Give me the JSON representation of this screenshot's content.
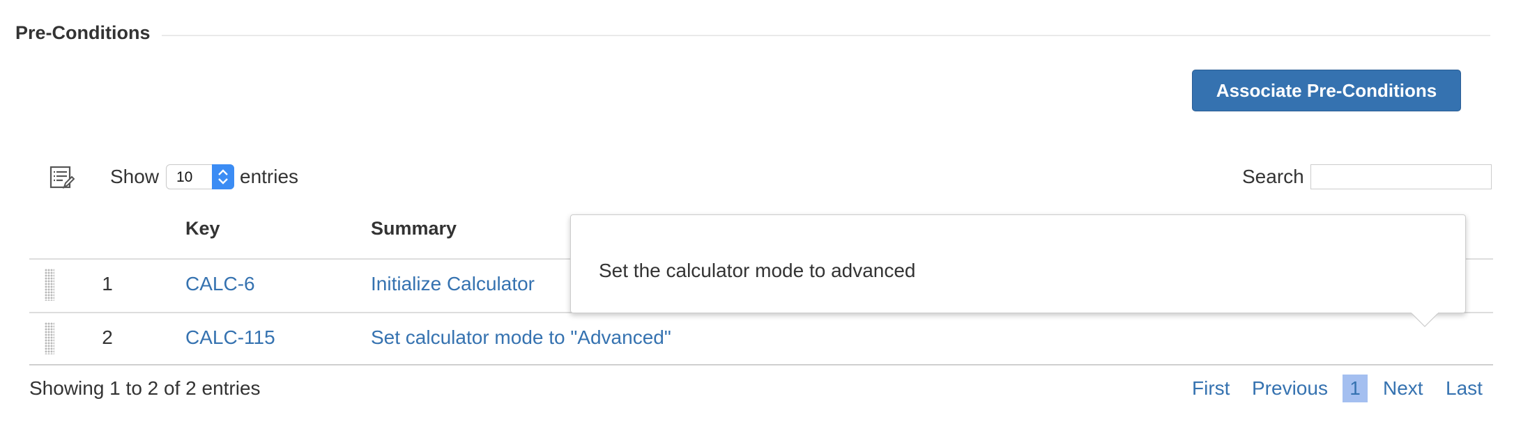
{
  "section": {
    "title": "Pre-Conditions"
  },
  "toolbar": {
    "associate_label": "Associate Pre-Conditions"
  },
  "controls": {
    "show_label": "Show",
    "length_value": "10",
    "entries_label": "entries",
    "search_label": "Search",
    "search_value": ""
  },
  "table": {
    "headers": {
      "key": "Key",
      "summary": "Summary"
    },
    "rows": [
      {
        "num": "1",
        "key": "CALC-6",
        "summary": "Initialize Calculator"
      },
      {
        "num": "2",
        "key": "CALC-115",
        "summary": "Set calculator mode to \"Advanced\""
      }
    ]
  },
  "footer": {
    "info": "Showing 1 to 2 of 2 entries",
    "first": "First",
    "previous": "Previous",
    "current_page": "1",
    "next": "Next",
    "last": "Last"
  },
  "tooltip": {
    "text": "Set the calculator mode to advanced"
  },
  "icons": {
    "column_chooser": "column-list-edit-icon",
    "drag_handle": "drag-grip-icon",
    "select_arrows": "up-down-chevron-icon"
  },
  "colors": {
    "accent": "#3572b0",
    "button_bg": "#3572b0",
    "current_page_bg": "#a4bff0",
    "select_arrow_bg": "#3b8cf4"
  }
}
